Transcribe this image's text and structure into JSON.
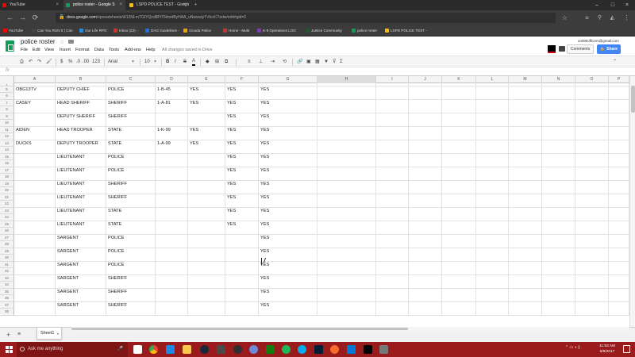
{
  "browser": {
    "tabs": [
      {
        "label": "YouTube",
        "color": "#ff0000"
      },
      {
        "label": "police roster - Google S",
        "color": "#0f9d58"
      },
      {
        "label": "LSPD POLICE TEST - Google",
        "color": "#fbbc05"
      }
    ],
    "url_prefix": "docs.google.com",
    "url_rest": "/spreadsheets/d/13NLmTGIYQcd8PiT5lmetByHAA_uNwwuiyTVtczC7edw/edit#gid=0",
    "bookmarks": [
      {
        "label": "YouTube",
        "color": "#ff0000"
      },
      {
        "label": "Can You RUN It | Can",
        "color": "#444444"
      },
      {
        "label": "Our Life RPG",
        "color": "#2a8bd8"
      },
      {
        "label": "Inbox (22) -",
        "color": "#d93025"
      },
      {
        "label": "DAG Guidelines -",
        "color": "#1a73e8"
      },
      {
        "label": "Cicada Police",
        "color": "#f4a300"
      },
      {
        "label": "Home - Multi",
        "color": "#cc3333"
      },
      {
        "label": "K-9 Operations LOG",
        "color": "#7e3fb0"
      },
      {
        "label": "Justice Community",
        "color": "#1b5e20"
      },
      {
        "label": "police roster",
        "color": "#0f9d58"
      },
      {
        "label": "LSPD POLICE TEST -",
        "color": "#fbbc05"
      }
    ]
  },
  "doc": {
    "title": "police roster",
    "menus": [
      "File",
      "Edit",
      "View",
      "Insert",
      "Format",
      "Data",
      "Tools",
      "Add-ons",
      "Help"
    ],
    "save_status": "All changes saved in Drive",
    "user_email": "unit90officers@gmail.com",
    "comments_label": "Comments",
    "share_label": "Share"
  },
  "toolbar": {
    "zoom": "123",
    "font": "Arial",
    "font_size": "10",
    "currency": "$",
    "percent": "%",
    "decimal_less": ".0",
    "decimal_more": ".00",
    "bold": "B",
    "italic": "I",
    "strike": "S",
    "text_color": "A",
    "sum": "Σ"
  },
  "formula": {
    "fx": "fx",
    "value": ""
  },
  "grid": {
    "columns": [
      "A",
      "B",
      "C",
      "D",
      "E",
      "F",
      "G",
      "H",
      "I",
      "J",
      "K",
      "L",
      "M",
      "N",
      "O",
      "P"
    ],
    "selected_column": "H",
    "rows": [
      {
        "n": "4",
        "num_top": "",
        "cells": [
          "",
          "",
          "",
          "",
          "",
          "",
          ""
        ],
        "thin": true
      },
      {
        "n": "5",
        "num2": "6",
        "cells": [
          "OBG13TV",
          "DEPUTY CHIEF",
          "POLICE",
          "1-B-45",
          "YES",
          "YES",
          "YES"
        ]
      },
      {
        "n": "7",
        "num2": "8",
        "cells": [
          "CASEY",
          "HEAD SHERIFF",
          "SHERIFF",
          "1-A-81",
          "YES",
          "YES",
          "YES"
        ]
      },
      {
        "n": "9",
        "num2": "10",
        "cells": [
          "",
          "DEPUTY SHERIFF",
          "SHERIFF",
          "",
          "",
          "YES",
          "YES"
        ]
      },
      {
        "n": "11",
        "num2": "12",
        "cells": [
          "AIDEN",
          "HEAD TROOPER",
          "STATE",
          "1-K-99",
          "YES",
          "YES",
          "YES"
        ]
      },
      {
        "n": "13",
        "num2": "14",
        "cells": [
          "DUCKS",
          "DEPUTY TROOPER",
          "STATE",
          "1-A-99",
          "YES",
          "YES",
          "YES"
        ]
      },
      {
        "n": "15",
        "num2": "16",
        "cells": [
          "",
          "LIEUTENANT",
          "POLICE",
          "",
          "",
          "YES",
          "YES"
        ]
      },
      {
        "n": "17",
        "num2": "18",
        "cells": [
          "",
          "LIEUTENANT",
          "POLICE",
          "",
          "",
          "YES",
          "YES"
        ]
      },
      {
        "n": "19",
        "num2": "20",
        "cells": [
          "",
          "LIEUTENANT",
          "SHERIFF",
          "",
          "",
          "YES",
          "YES"
        ]
      },
      {
        "n": "21",
        "num2": "22",
        "cells": [
          "",
          "LIEUTENANT",
          "SHERIFF",
          "",
          "",
          "YES",
          "YES"
        ]
      },
      {
        "n": "23",
        "num2": "24",
        "cells": [
          "",
          "LIEUTENANT",
          "STATE",
          "",
          "",
          "YES",
          "YES"
        ]
      },
      {
        "n": "25",
        "num2": "26",
        "cells": [
          "",
          "LIEUTENANT",
          "STATE",
          "",
          "",
          "YES",
          "YES"
        ]
      },
      {
        "n": "27",
        "num2": "28",
        "cells": [
          "",
          "SARGENT",
          "POLICE",
          "",
          "",
          "",
          "YES"
        ]
      },
      {
        "n": "29",
        "num2": "30",
        "cells": [
          "",
          "SARGENT",
          "POLICE",
          "",
          "",
          "",
          "YES"
        ]
      },
      {
        "n": "31",
        "num2": "32",
        "cells": [
          "",
          "SARGENT",
          "POLICE",
          "",
          "",
          "",
          "YES"
        ]
      },
      {
        "n": "33",
        "num2": "34",
        "cells": [
          "",
          "SARGENT",
          "SHERIFF",
          "",
          "",
          "",
          "YES"
        ]
      },
      {
        "n": "35",
        "num2": "36",
        "cells": [
          "",
          "SARGENT",
          "SHERIFF",
          "",
          "",
          "",
          "YES"
        ]
      },
      {
        "n": "37",
        "num2": "38",
        "cells": [
          "",
          "SARGENT",
          "SHERIFF",
          "",
          "",
          "",
          "YES"
        ]
      }
    ]
  },
  "sheets": {
    "active": "Sheet1"
  },
  "taskbar": {
    "search_placeholder": "Ask me anything",
    "time": "11:53 AM",
    "date": "6/8/2017",
    "accent": "#9a1b1b"
  }
}
